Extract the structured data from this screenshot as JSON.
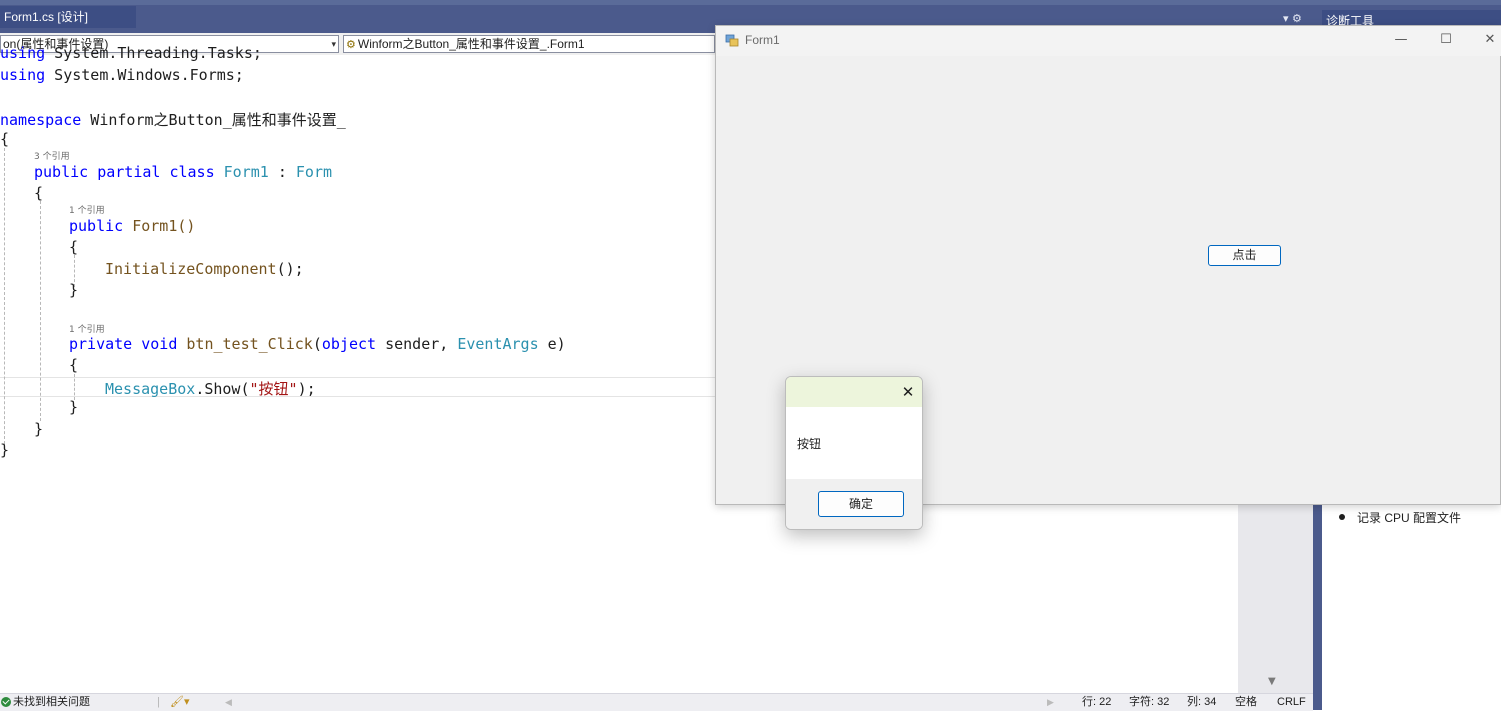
{
  "editor_tab": {
    "title": "Form1.cs [设计]"
  },
  "tab_controls": "▾ ⚙",
  "diagnostics": {
    "panel_title": "诊断工具",
    "item": "记录 CPU 配置文件"
  },
  "nav": {
    "left_dropdown": "on(属性和事件设置)",
    "right_dropdown": "Winform之Button_属性和事件设置_.Form1",
    "dropdown_arrow": "▾"
  },
  "code": {
    "line_partial": {
      "kw": "using",
      "rest": " System.Threading.Tasks;"
    },
    "line_using": {
      "kw": "using",
      "rest": " System.Windows.Forms;"
    },
    "line_namespace": {
      "kw": "namespace",
      "rest": " Winform之Button_属性和事件设置_"
    },
    "brace_open": "{",
    "brace_close": "}",
    "lens_class": "3 个引用",
    "class_kw": "public partial class",
    "class_name": " Form1",
    "class_colon": " : ",
    "class_base": "Form",
    "lens_ctor": "1 个引用",
    "ctor_kw": "public",
    "ctor_name": " Form1()",
    "ctor_body": "InitializeComponent",
    "ctor_body_rest": "();",
    "lens_method": "1 个引用",
    "method_kw": "private void",
    "method_name": " btn_test_Click",
    "method_paren": "(",
    "method_param_kw": "object",
    "method_param1": " sender, ",
    "method_param_type": "EventArgs",
    "method_param2": " e)",
    "stmt_type": "MessageBox",
    "stmt_call": ".Show(",
    "stmt_str": "\"按钮\"",
    "stmt_end": ");"
  },
  "status": {
    "issues": "未找到相关问题",
    "line": "行: 22",
    "char": "字符: 32",
    "col": "列: 34",
    "spaces": "空格",
    "eol": "CRLF"
  },
  "form1": {
    "title": "Form1",
    "minimize": "—",
    "maximize": "☐",
    "close": "✕",
    "button_label": "点击"
  },
  "messagebox": {
    "text": "按钮",
    "ok_label": "确定",
    "close": "✕"
  },
  "colors": {
    "tab_bar": "#4b5a8c",
    "keyword": "#0000ff",
    "type": "#2b91af",
    "string": "#a31515",
    "button_border": "#0067c0"
  }
}
